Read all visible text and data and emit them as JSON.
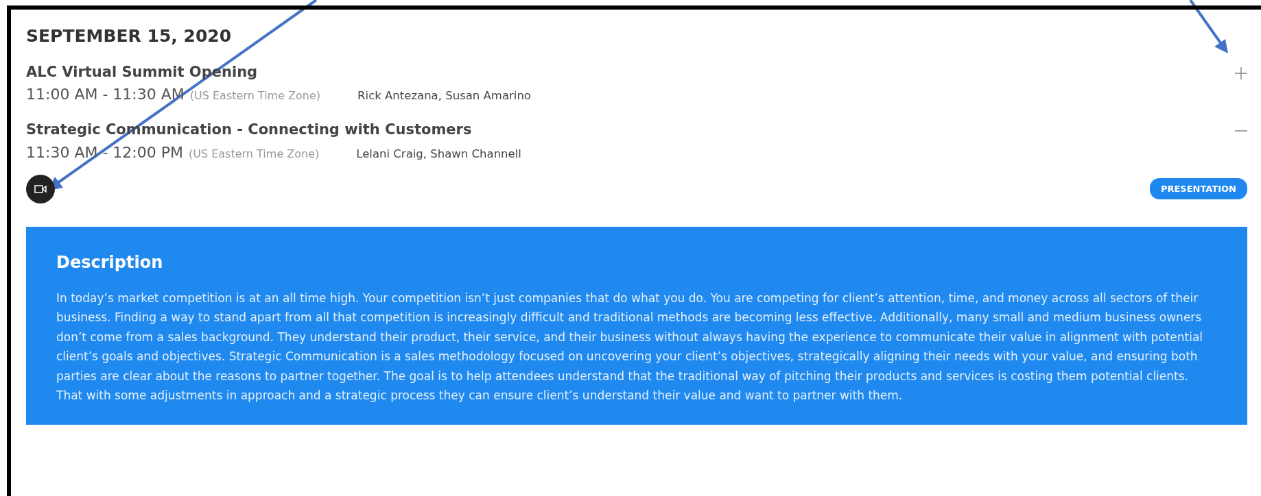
{
  "date": "SEPTEMBER 15, 2020",
  "sessions": [
    {
      "title": "ALC Virtual Summit Opening",
      "time": "11:00 AM - 11:30 AM",
      "timezone": "(US Eastern Time Zone)",
      "speakers": "Rick Antezana, Susan Amarino",
      "expanded": false
    },
    {
      "title": "Strategic Communication - Connecting with Customers",
      "time": "11:30 AM - 12:00 PM",
      "timezone": "(US Eastern Time Zone)",
      "speakers": "Lelani Craig, Shawn Channell",
      "expanded": true,
      "badge": "PRESENTATION",
      "description": {
        "heading": "Description",
        "body": "In today’s market competition is at an all time high. Your competition isn’t just companies that do what you do. You are competing for client’s attention, time, and money across all sectors of their business. Finding a way to stand apart from all that competition is increasingly difficult and traditional methods are becoming less effective. Additionally, many small and medium business owners don’t come from a sales background. They understand their product, their service, and their business without always having the experience to communicate their value in alignment with potential client’s goals and objectives. Strategic Communication is a sales methodology focused on uncovering your client’s objectives, strategically aligning their needs with your value, and ensuring both parties are clear about the reasons to partner together. The goal is to help attendees understand that the traditional way of pitching their products and services is costing them potential clients. That with some adjustments in approach and a strategic process they can ensure client’s understand their value and want to partner with them."
      }
    }
  ]
}
